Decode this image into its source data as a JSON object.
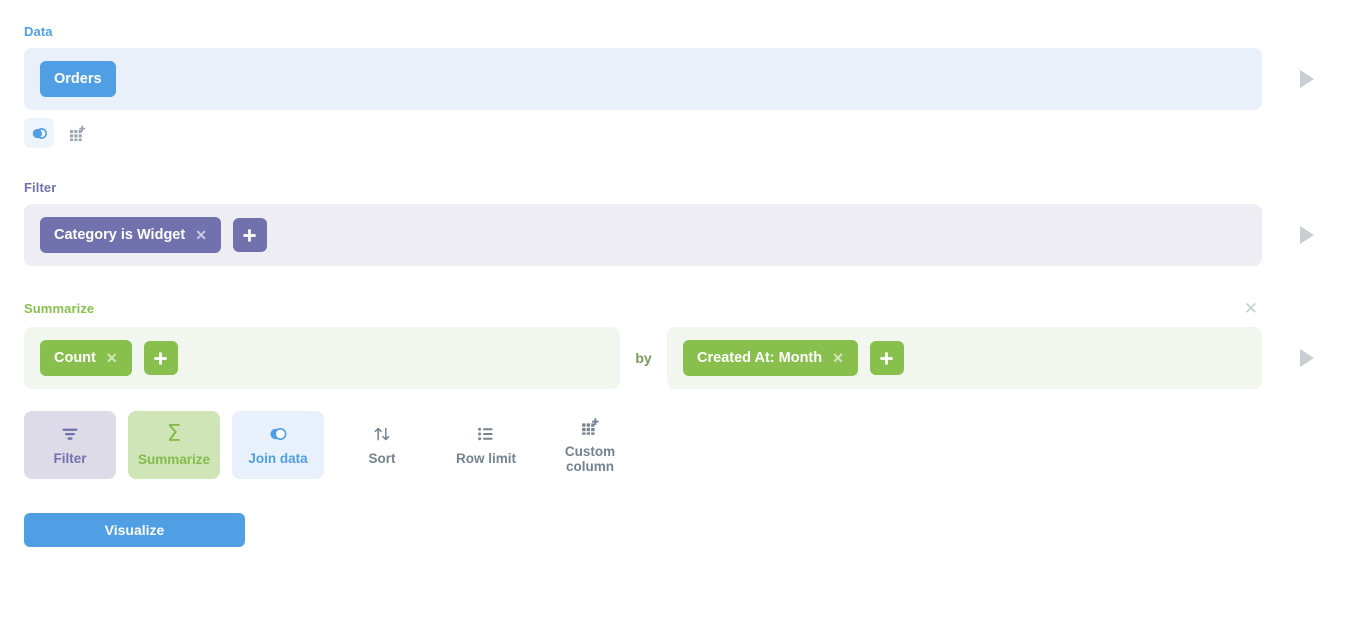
{
  "sections": {
    "data": {
      "label": "Data",
      "table_chip": "Orders",
      "mini_icons": [
        {
          "name": "join-data-icon",
          "active": true
        },
        {
          "name": "custom-column-icon",
          "active": false
        }
      ],
      "preview_icon": "play-icon"
    },
    "filter": {
      "label": "Filter",
      "chips": [
        {
          "text": "Category is Widget",
          "remove_icon": "close-icon"
        }
      ],
      "add_icon": "plus-icon",
      "preview_icon": "play-icon"
    },
    "summarize": {
      "label": "Summarize",
      "remove_icon": "close-icon",
      "metric_chips": [
        {
          "text": "Count",
          "remove_icon": "close-icon"
        }
      ],
      "metric_add_icon": "plus-icon",
      "by_label": "by",
      "breakout_chips": [
        {
          "text": "Created At: Month",
          "remove_icon": "close-icon"
        }
      ],
      "breakout_add_icon": "plus-icon",
      "preview_icon": "play-icon"
    }
  },
  "action_tiles": [
    {
      "label": "Filter",
      "icon": "filter-funnel-icon",
      "style": "filter"
    },
    {
      "label": "Summarize",
      "icon": "sigma-icon",
      "style": "summarize"
    },
    {
      "label": "Join data",
      "icon": "join-data-icon",
      "style": "join"
    },
    {
      "label": "Sort",
      "icon": "sort-arrows-icon",
      "style": "plain"
    },
    {
      "label": "Row limit",
      "icon": "list-icon",
      "style": "plain"
    },
    {
      "label": "Custom column",
      "icon": "custom-column-icon",
      "style": "plain"
    }
  ],
  "footer": {
    "visualize_label": "Visualize"
  },
  "colors": {
    "data_accent": "#509ee3",
    "filter_accent": "#7172ad",
    "summarize_accent": "#88bf4d",
    "data_panel_bg": "#e9f0fa",
    "filter_panel_bg": "#eeedf4",
    "summarize_panel_bg": "#f1f7ef",
    "muted": "#74838f",
    "play_arrow": "#c7ced4"
  }
}
